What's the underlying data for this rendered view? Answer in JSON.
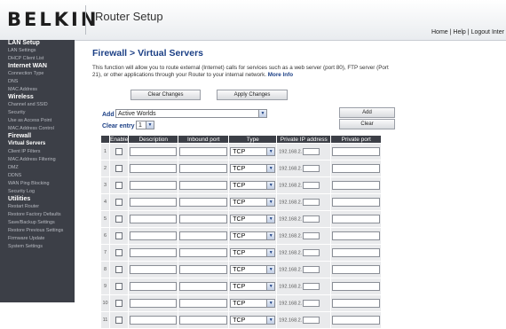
{
  "header": {
    "logo": "BELKIN",
    "app_title": "Router Setup",
    "links": {
      "home": "Home",
      "help": "Help",
      "logout": "Logout",
      "internet": "Inter",
      "sep": "|"
    }
  },
  "sidebar": {
    "sections": [
      {
        "title": "LAN Setup",
        "items": [
          "LAN Settings",
          "DHCP Client List"
        ]
      },
      {
        "title": "Internet WAN",
        "items": [
          "Connection Type",
          "DNS",
          "MAC Address"
        ]
      },
      {
        "title": "Wireless",
        "items": [
          "Channel and SSID",
          "Security",
          "Use as Access Point",
          "MAC Address Control"
        ]
      },
      {
        "title": "Firewall",
        "items": [
          "Virtual Servers",
          "Client IP Filters",
          "MAC Address Filtering",
          "DMZ",
          "DDNS",
          "WAN Ping Blocking",
          "Security Log"
        ]
      },
      {
        "title": "Utilities",
        "items": [
          "Restart Router",
          "Restore Factory Defaults",
          "Save/Backup Settings",
          "Restore Previous Settings",
          "Firmware Update",
          "System Settings"
        ]
      }
    ]
  },
  "page": {
    "title": "Firewall > Virtual Servers",
    "description": "This function will allow you to route external (Internet) calls for services such as a web server (port 80), FTP server (Port 21), or other applications through your Router to your internal network.",
    "more_info": "More Info",
    "clear_changes": "Clear Changes",
    "apply_changes": "Apply Changes",
    "add_label": "Add",
    "add_select_value": "Active Worlds",
    "add_button": "Add",
    "clear_entry_label": "Clear entry",
    "clear_entry_value": "1",
    "clear_button": "Clear"
  },
  "table": {
    "headers": {
      "enable": "Enable",
      "description": "Description",
      "inbound": "Inbound port",
      "type": "Type",
      "private_ip": "Private IP address",
      "private_port": "Private port"
    },
    "rows": [
      {
        "num": "1",
        "type": "TCP",
        "ip": "192.168.2."
      },
      {
        "num": "2",
        "type": "TCP",
        "ip": "192.168.2."
      },
      {
        "num": "3",
        "type": "TCP",
        "ip": "192.168.2."
      },
      {
        "num": "4",
        "type": "TCP",
        "ip": "192.168.2."
      },
      {
        "num": "5",
        "type": "TCP",
        "ip": "192.168.2."
      },
      {
        "num": "6",
        "type": "TCP",
        "ip": "192.168.2."
      },
      {
        "num": "7",
        "type": "TCP",
        "ip": "192.168.2."
      },
      {
        "num": "8",
        "type": "TCP",
        "ip": "192.168.2."
      },
      {
        "num": "9",
        "type": "TCP",
        "ip": "192.168.2."
      },
      {
        "num": "10",
        "type": "TCP",
        "ip": "192.168.2."
      },
      {
        "num": "11",
        "type": "TCP",
        "ip": "192.168.2."
      }
    ]
  },
  "icons": {
    "dropdown": "chevron-down-icon",
    "checkbox": "checkbox-icon"
  },
  "colors": {
    "sidebar_bg": "#3c3f47",
    "title_blue": "#1b3f85",
    "header_gradient_end": "#e9ecef"
  }
}
